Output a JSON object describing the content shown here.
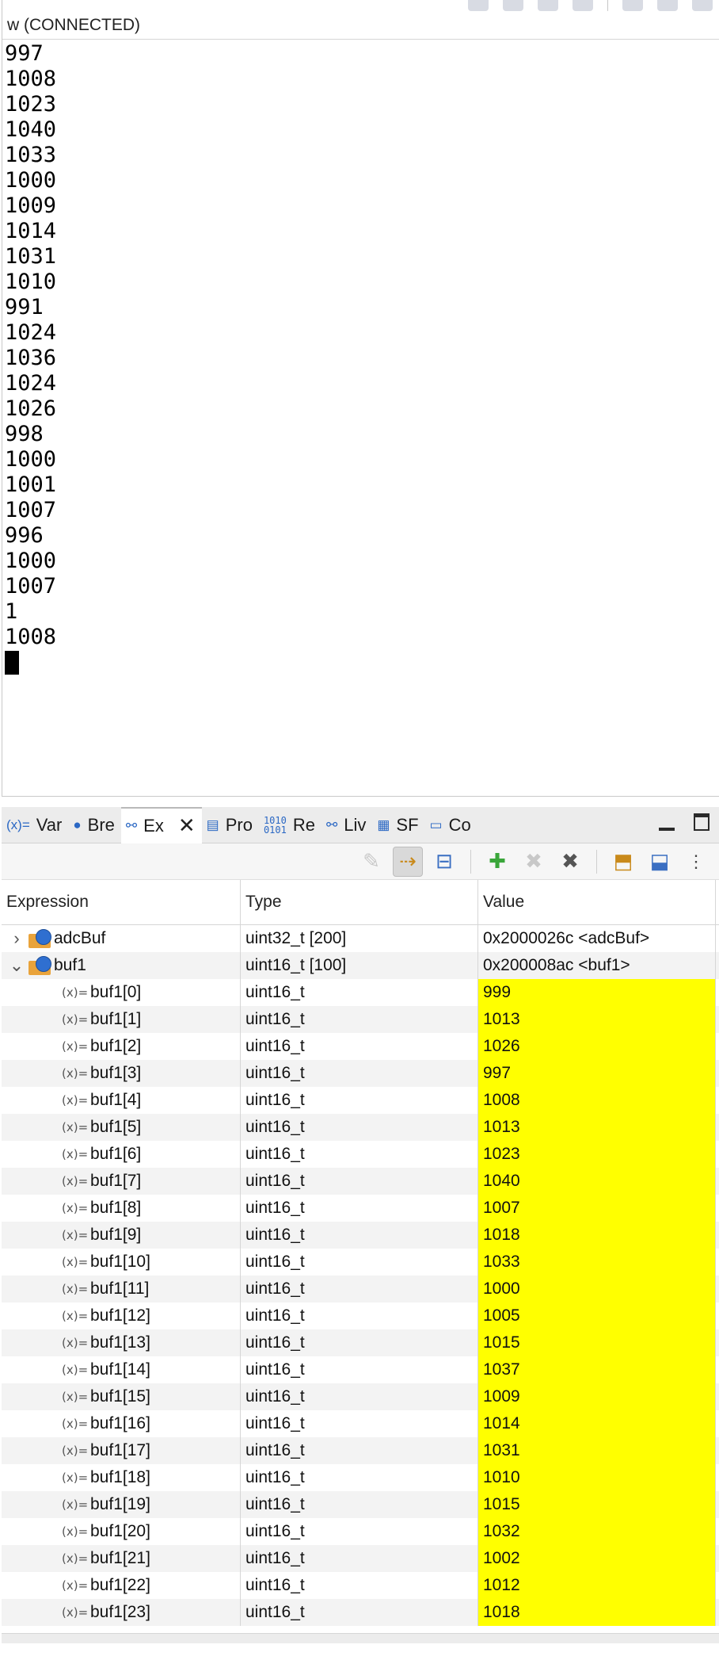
{
  "console": {
    "title": "w (CONNECTED)",
    "lines": [
      "997",
      "1008",
      "1023",
      "1040",
      "1033",
      "1000",
      "1009",
      "1014",
      "1031",
      "1010",
      "991",
      "1024",
      "1036",
      "1024",
      "1026",
      "998",
      "1000",
      "1001",
      "1007",
      "996",
      "1000",
      "1007",
      "1",
      "1008"
    ]
  },
  "tabs": [
    {
      "icon": "(x)=",
      "label": "Var",
      "name": "variables"
    },
    {
      "icon": "●",
      "label": "Bre",
      "name": "breakpoints"
    },
    {
      "icon": "⚯",
      "label": "Ex",
      "name": "expressions",
      "active": true
    },
    {
      "icon": "▤",
      "label": "Pro",
      "name": "properties"
    },
    {
      "icon": "1010\n0101",
      "label": "Re",
      "name": "registers"
    },
    {
      "icon": "⚯",
      "label": "Liv",
      "name": "live-expressions"
    },
    {
      "icon": "▦",
      "label": "SF",
      "name": "sfrs"
    },
    {
      "icon": "▭",
      "label": "Co",
      "name": "console"
    }
  ],
  "table": {
    "headers": {
      "expression": "Expression",
      "type": "Type",
      "value": "Value"
    },
    "roots": [
      {
        "name": "adcBuf",
        "type": "uint32_t [200]",
        "value": "0x2000026c <adcBuf>",
        "expanded": false
      },
      {
        "name": "buf1",
        "type": "uint16_t [100]",
        "value": "0x200008ac <buf1>",
        "expanded": true
      }
    ],
    "child_icon": "(x)=",
    "children": [
      {
        "name": "buf1[0]",
        "type": "uint16_t",
        "value": "999"
      },
      {
        "name": "buf1[1]",
        "type": "uint16_t",
        "value": "1013"
      },
      {
        "name": "buf1[2]",
        "type": "uint16_t",
        "value": "1026"
      },
      {
        "name": "buf1[3]",
        "type": "uint16_t",
        "value": "997"
      },
      {
        "name": "buf1[4]",
        "type": "uint16_t",
        "value": "1008"
      },
      {
        "name": "buf1[5]",
        "type": "uint16_t",
        "value": "1013"
      },
      {
        "name": "buf1[6]",
        "type": "uint16_t",
        "value": "1023"
      },
      {
        "name": "buf1[7]",
        "type": "uint16_t",
        "value": "1040"
      },
      {
        "name": "buf1[8]",
        "type": "uint16_t",
        "value": "1007"
      },
      {
        "name": "buf1[9]",
        "type": "uint16_t",
        "value": "1018"
      },
      {
        "name": "buf1[10]",
        "type": "uint16_t",
        "value": "1033"
      },
      {
        "name": "buf1[11]",
        "type": "uint16_t",
        "value": "1000"
      },
      {
        "name": "buf1[12]",
        "type": "uint16_t",
        "value": "1005"
      },
      {
        "name": "buf1[13]",
        "type": "uint16_t",
        "value": "1015"
      },
      {
        "name": "buf1[14]",
        "type": "uint16_t",
        "value": "1037"
      },
      {
        "name": "buf1[15]",
        "type": "uint16_t",
        "value": "1009"
      },
      {
        "name": "buf1[16]",
        "type": "uint16_t",
        "value": "1014"
      },
      {
        "name": "buf1[17]",
        "type": "uint16_t",
        "value": "1031"
      },
      {
        "name": "buf1[18]",
        "type": "uint16_t",
        "value": "1010"
      },
      {
        "name": "buf1[19]",
        "type": "uint16_t",
        "value": "1015"
      },
      {
        "name": "buf1[20]",
        "type": "uint16_t",
        "value": "1032"
      },
      {
        "name": "buf1[21]",
        "type": "uint16_t",
        "value": "1002"
      },
      {
        "name": "buf1[22]",
        "type": "uint16_t",
        "value": "1012"
      },
      {
        "name": "buf1[23]",
        "type": "uint16_t",
        "value": "1018"
      }
    ]
  },
  "colors": {
    "changed_value": "#ffff00",
    "alt_row": "#f3f3f3"
  }
}
